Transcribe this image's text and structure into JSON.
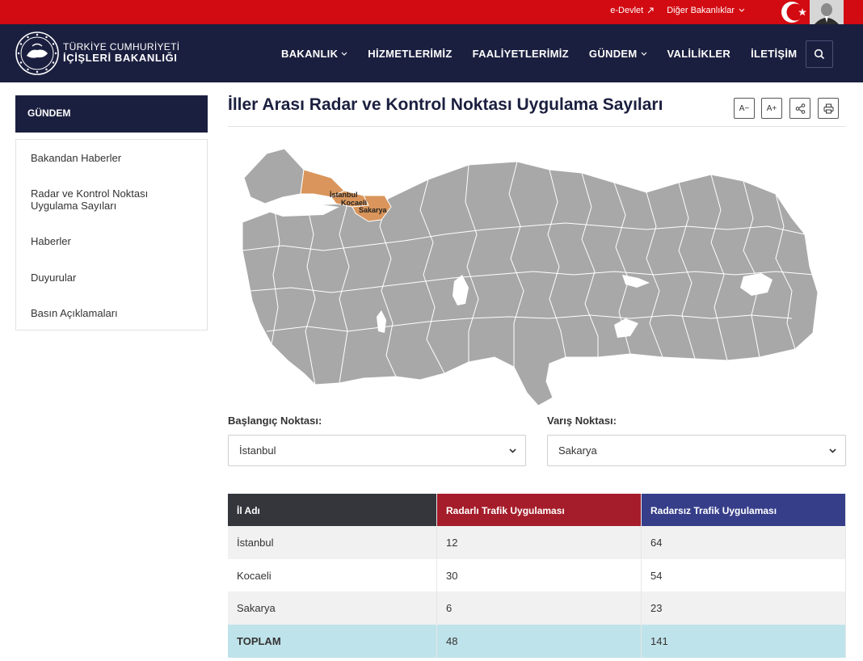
{
  "topbar": {
    "edevlet": "e-Devlet",
    "diger": "Diğer Bakanlıklar"
  },
  "brand": {
    "line1": "TÜRKİYE CUMHURİYETİ",
    "line2": "İÇİŞLERİ BAKANLIĞI"
  },
  "nav": {
    "items": [
      "BAKANLIK",
      "HİZMETLERİMİZ",
      "FAALİYETLERİMİZ",
      "GÜNDEM",
      "VALİLİKLER",
      "İLETİŞİM"
    ]
  },
  "sidebar": {
    "heading": "GÜNDEM",
    "items": [
      "Bakandan Haberler",
      "Radar ve Kontrol Noktası Uygulama Sayıları",
      "Haberler",
      "Duyurular",
      "Basın Açıklamaları"
    ]
  },
  "page": {
    "title": "İller Arası Radar ve Kontrol Noktası Uygulama Sayıları",
    "font_decrease": "A−",
    "font_increase": "A+"
  },
  "map": {
    "highlight_color": "#d9955b",
    "base_color": "#a8a8a8",
    "labels": [
      "İstanbul",
      "Kocaeli",
      "Sakarya"
    ]
  },
  "form": {
    "start_label": "Başlangıç Noktası:",
    "start_value": "İstanbul",
    "end_label": "Varış Noktası:",
    "end_value": "Sakarya"
  },
  "table": {
    "headers": [
      "İl Adı",
      "Radarlı Trafik Uygulaması",
      "Radarsız Trafik Uygulaması"
    ],
    "rows": [
      [
        "İstanbul",
        "12",
        "64"
      ],
      [
        "Kocaeli",
        "30",
        "54"
      ],
      [
        "Sakarya",
        "6",
        "23"
      ]
    ],
    "total": [
      "TOPLAM",
      "48",
      "141"
    ]
  }
}
